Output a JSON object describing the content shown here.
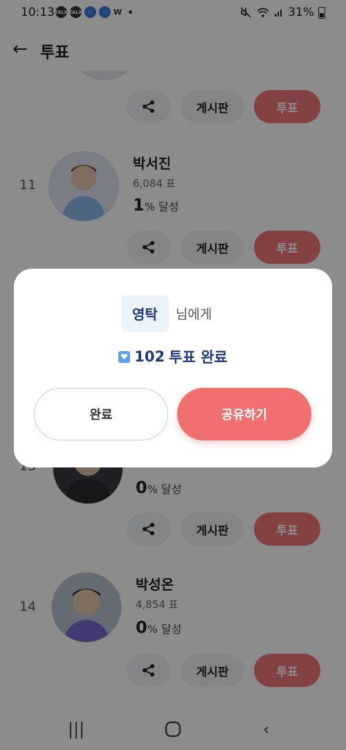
{
  "status": {
    "time": "10:13",
    "battery": "31%",
    "notifications": [
      "TALK",
      "TALK",
      "♡",
      "♡",
      "W"
    ]
  },
  "header": {
    "back_icon": "arrow-left-icon",
    "title": "투표"
  },
  "rows": [
    {
      "rank": "",
      "name": "",
      "votes": "",
      "pct_value": "",
      "pct_suffix": ""
    },
    {
      "rank": "11",
      "name": "박서진",
      "votes": "6,084 표",
      "pct_value": "1",
      "pct_suffix": "% 달성"
    },
    {
      "rank": "13",
      "name": "",
      "votes": "",
      "pct_value": "0",
      "pct_suffix": "% 달성"
    },
    {
      "rank": "14",
      "name": "박성온",
      "votes": "4,854 표",
      "pct_value": "0",
      "pct_suffix": "% 달성"
    }
  ],
  "row_actions": {
    "board_label": "게시판",
    "vote_label": "투표"
  },
  "dialog": {
    "recipient": "영탁",
    "recipient_suffix": "님에게",
    "vote_count": "102",
    "result_text": "투표 완료",
    "done_label": "완료",
    "share_label": "공유하기"
  },
  "colors": {
    "accent": "#f07070",
    "navy": "#1e3a78",
    "chip_bg": "#edf3fb"
  }
}
